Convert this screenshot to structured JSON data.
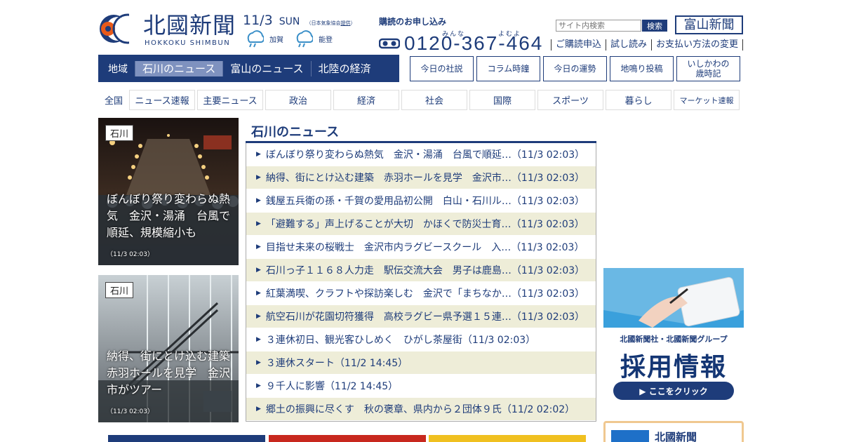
{
  "header": {
    "logo_name": "北國新聞",
    "logo_roman": "HOKKOKU SHIMBUN",
    "date": "11/3",
    "dow": "SUN",
    "credit": "（日本気象協会",
    "credit_link": "提供",
    "credit_end": "）",
    "weather": [
      {
        "place": "加賀",
        "icon": "rain-icon"
      },
      {
        "place": "能登",
        "icon": "rain-icon"
      }
    ],
    "subscribe_label": "購読のお申し込み",
    "ruby_1": "みんな",
    "ruby_2": "よむよ",
    "phone": "0120-367-464",
    "search_placeholder": "サイト内検索",
    "search_button": "検索",
    "toyama_button": "富山新聞",
    "toplinks": [
      "ご購読申込",
      "試し読み",
      "お支払い方法の変更"
    ]
  },
  "region_nav": {
    "label": "地域",
    "tabs": [
      "石川のニュース",
      "富山のニュース",
      "北陸の経済"
    ]
  },
  "buttons": [
    "今日の社説",
    "コラム時鐘",
    "今日の運勢",
    "地鳴り投稿",
    "いしかわの\n歳時記"
  ],
  "categories": {
    "label": "全国",
    "items": [
      "ニュース速報",
      "主要ニュース",
      "政治",
      "経済",
      "社会",
      "国際",
      "スポーツ",
      "暮らし",
      "マーケット速報"
    ]
  },
  "features": [
    {
      "tag": "石川",
      "caption": "ぼんぼり祭り変わらぬ熱気　金沢・湯涌　台風で順延、規模縮小も",
      "time": "（11/3 02:03）"
    },
    {
      "tag": "石川",
      "caption": "納得、街にとけ込む建築　赤羽ホールを見学　金沢市がツアー",
      "time": "（11/3 02:03）"
    }
  ],
  "news": {
    "title": "石川のニュース",
    "items": [
      "ぼんぼり祭り変わらぬ熱気　金沢・湯涌　台風で順延…（11/3 02:03）",
      "納得、街にとけ込む建築　赤羽ホールを見学　金沢市…（11/3 02:03）",
      "銭屋五兵衛の孫・千賀の愛用品初公開　白山・石川ル…（11/3 02:03）",
      "「避難する」声上げることが大切　かほくで防災士育…（11/3 02:03）",
      "目指せ未来の桜戦士　金沢市内ラグビースクール　入…（11/3 02:03）",
      "石川っ子１１６８人力走　駅伝交流大会　男子は鹿島…（11/3 02:03）",
      "紅葉満喫、クラフトや探訪楽しむ　金沢で「まちなか…（11/3 02:03）",
      "航空石川が花園切符獲得　高校ラグビー県予選１５連…（11/3 02:03）",
      "３連休初日、観光客ひしめく　ひがし茶屋街（11/3 02:03）",
      "３連休スタート（11/2 14:45）",
      "９千人に影響（11/2 14:45）",
      "郷土の振興に尽くす　秋の褒章、県内から２団体９氏（11/2 02:02）"
    ]
  },
  "recruit_ad": {
    "line1": "北國新聞社・北國新聞グループ",
    "line2": "採用情報",
    "cta": "▶ ここをクリック"
  },
  "promo": {
    "text": "北國新聞"
  },
  "colors": {
    "brand": "#1e3c7a",
    "stripe": "#eeedd8",
    "active_tab": "#7f92bf"
  }
}
